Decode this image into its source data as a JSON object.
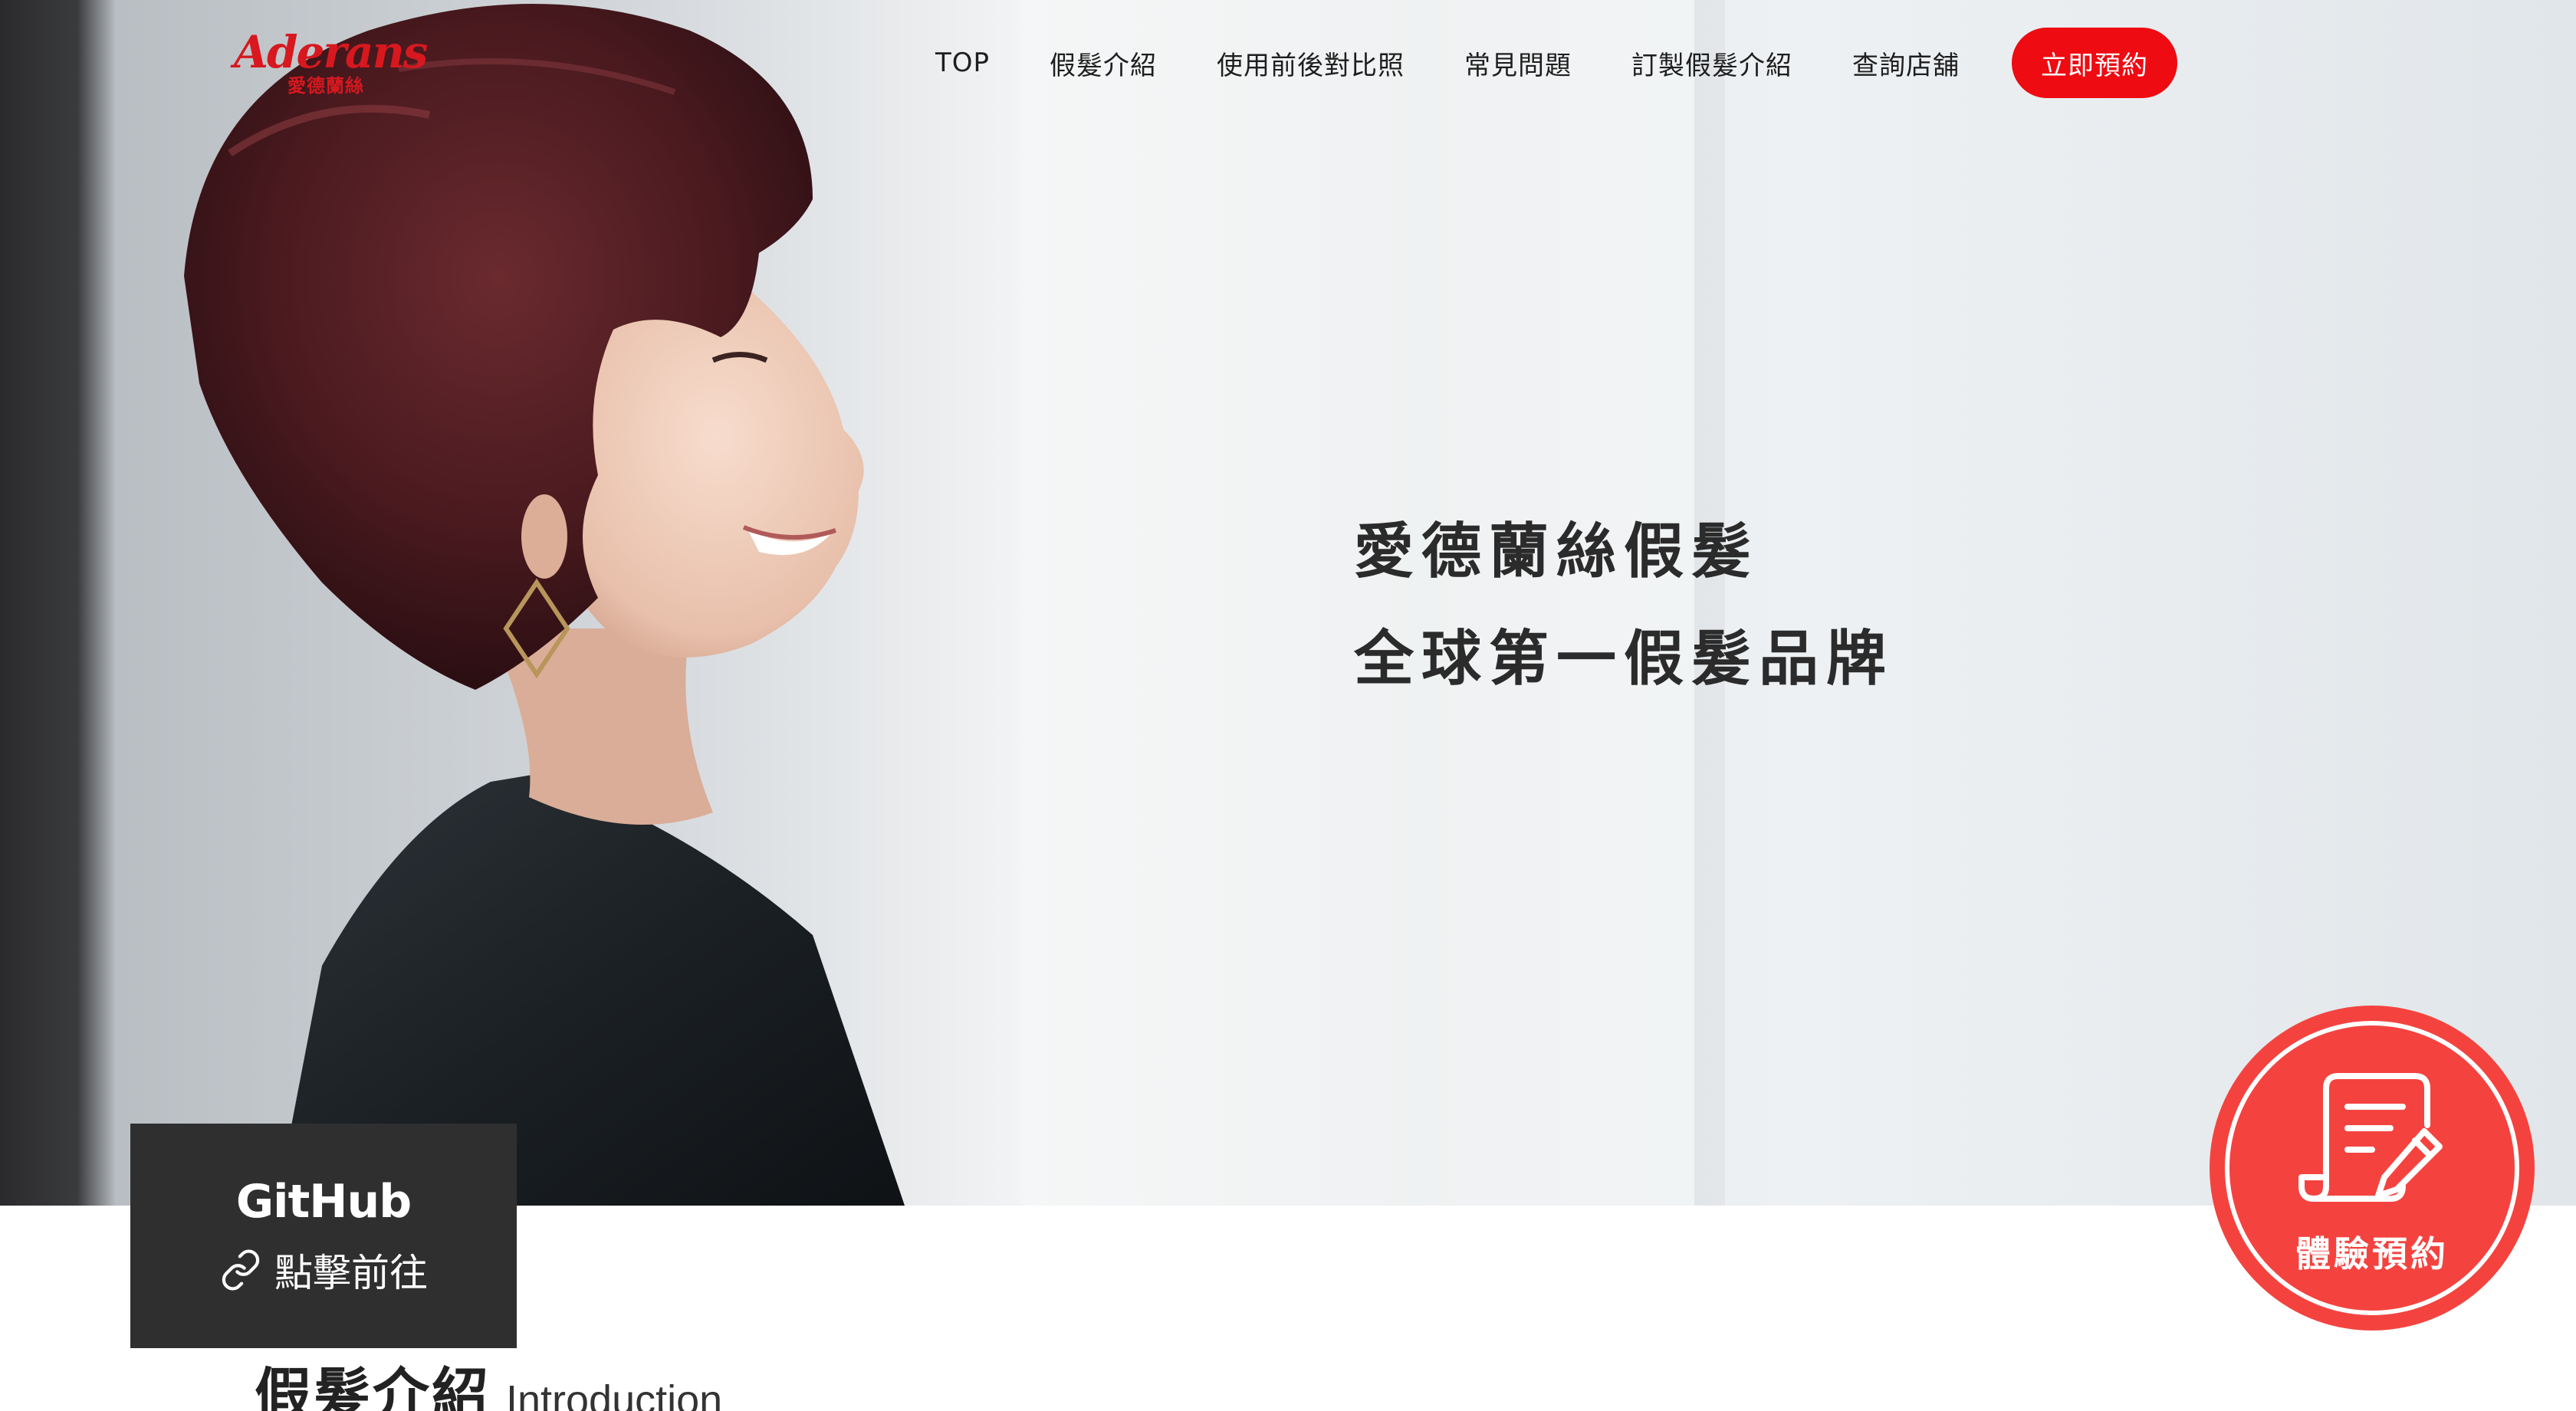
{
  "header": {
    "logo_text": "Aderans",
    "logo_subtext": "愛德蘭絲",
    "nav": [
      {
        "label": "TOP"
      },
      {
        "label": "假髮介紹"
      },
      {
        "label": "使用前後對比照"
      },
      {
        "label": "常見問題"
      },
      {
        "label": "訂製假髮介紹"
      },
      {
        "label": "查詢店舖"
      }
    ],
    "cta_label": "立即預約"
  },
  "hero": {
    "headline_line1": "愛德蘭絲假髮",
    "headline_line2": "全球第一假髮品牌"
  },
  "github_card": {
    "title": "GitHub",
    "link_label": "點擊前往",
    "icon": "link-icon"
  },
  "booking_badge": {
    "label": "體驗預約",
    "icon": "document-pen-icon"
  },
  "section": {
    "title_zh": "假髮介紹",
    "title_en": "Introduction"
  },
  "colors": {
    "brand_red": "#d7181f",
    "cta_red": "#ee0b12",
    "badge_red": "#f4433f",
    "card_dark": "#2f2f2f"
  }
}
